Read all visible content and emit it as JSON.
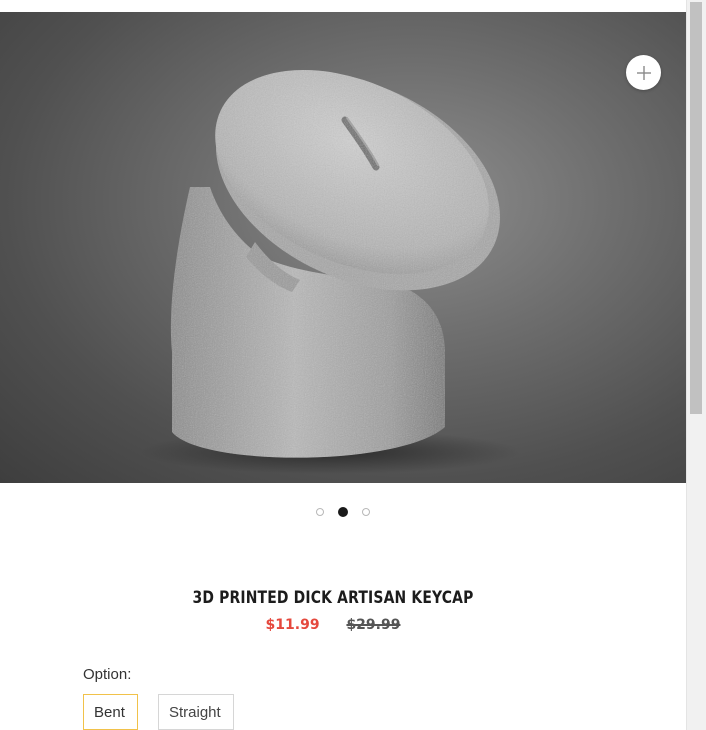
{
  "product": {
    "title": "3D PRINTED DICK ARTISAN KEYCAP",
    "sale_price": "$11.99",
    "compare_price": "$29.99"
  },
  "gallery": {
    "image_subject": "gray 3D printed keycap",
    "slide_count": 3,
    "active_slide": 2,
    "zoom_icon": "plus-icon"
  },
  "options": {
    "label": "Option:",
    "values": [
      "Bent",
      "Straight"
    ],
    "selected": "Bent"
  },
  "colors": {
    "sale_price": "#e5483d",
    "selected_border": "#f1c24a"
  }
}
